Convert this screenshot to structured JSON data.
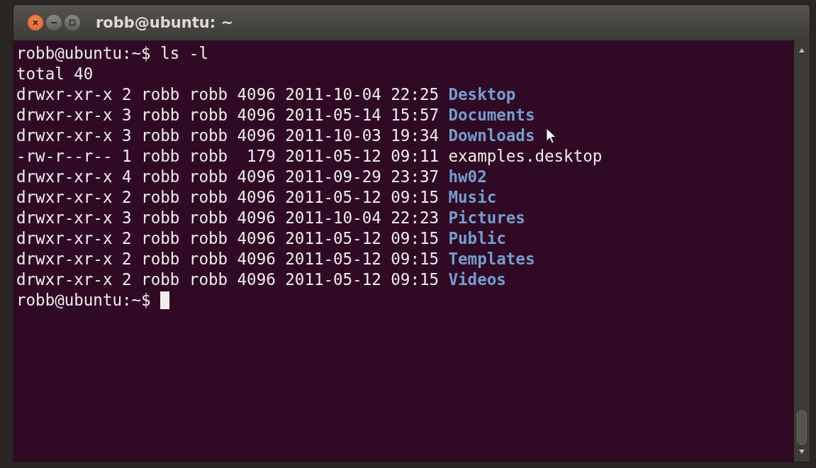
{
  "window": {
    "title": "robb@ubuntu: ~"
  },
  "lines": [
    {
      "kind": "prompt",
      "prompt": "robb@ubuntu:~$",
      "command": "ls -l"
    },
    {
      "kind": "text",
      "text": "total 40"
    },
    {
      "kind": "entry",
      "details": "drwxr-xr-x 2 robb robb 4096 2011-10-04 22:25",
      "name": "Desktop",
      "directory": true
    },
    {
      "kind": "entry",
      "details": "drwxr-xr-x 3 robb robb 4096 2011-05-14 15:57",
      "name": "Documents",
      "directory": true
    },
    {
      "kind": "entry",
      "details": "drwxr-xr-x 3 robb robb 4096 2011-10-03 19:34",
      "name": "Downloads",
      "directory": true
    },
    {
      "kind": "entry",
      "details": "-rw-r--r-- 1 robb robb  179 2011-05-12 09:11",
      "name": "examples.desktop",
      "directory": false
    },
    {
      "kind": "entry",
      "details": "drwxr-xr-x 4 robb robb 4096 2011-09-29 23:37",
      "name": "hw02",
      "directory": true
    },
    {
      "kind": "entry",
      "details": "drwxr-xr-x 2 robb robb 4096 2011-05-12 09:15",
      "name": "Music",
      "directory": true
    },
    {
      "kind": "entry",
      "details": "drwxr-xr-x 3 robb robb 4096 2011-10-04 22:23",
      "name": "Pictures",
      "directory": true
    },
    {
      "kind": "entry",
      "details": "drwxr-xr-x 2 robb robb 4096 2011-05-12 09:15",
      "name": "Public",
      "directory": true
    },
    {
      "kind": "entry",
      "details": "drwxr-xr-x 2 robb robb 4096 2011-05-12 09:15",
      "name": "Templates",
      "directory": true
    },
    {
      "kind": "entry",
      "details": "drwxr-xr-x 2 robb robb 4096 2011-05-12 09:15",
      "name": "Videos",
      "directory": true
    },
    {
      "kind": "prompt",
      "prompt": "robb@ubuntu:~$",
      "cursor": true
    }
  ]
}
